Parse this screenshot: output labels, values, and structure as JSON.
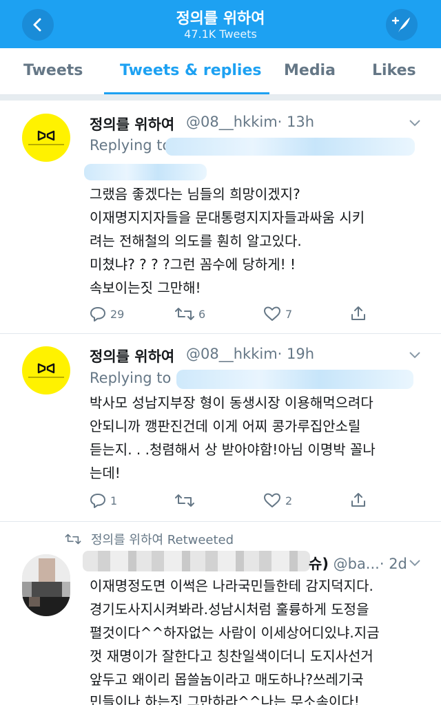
{
  "header": {
    "title": "정의를 위하여",
    "subtitle": "47.1K Tweets",
    "back_icon": "chevron-left-icon",
    "compose_icon": "compose-tweet-icon"
  },
  "tabs": [
    {
      "label": "Tweets",
      "active": false
    },
    {
      "label": "Tweets & replies",
      "active": true
    },
    {
      "label": "Media",
      "active": false
    },
    {
      "label": "Likes",
      "active": false
    }
  ],
  "tweets": [
    {
      "name": "정의를 위하여",
      "handle": "@08__hkkim",
      "time": "· 13h",
      "replying": "Replying to",
      "lines": [
        "그랬음 좋겠다는 님들의 희망이겠지?",
        "이재명지지자들을 문대통령지지자들과싸움 시키",
        "려는 전해철의 의도를 훤히 알고있다.",
        "미쳤냐? ? ? ?그런 꼼수에 당하게! !",
        "속보이는짓 그만해!"
      ],
      "replies": "29",
      "retweets": "6",
      "likes": "7"
    },
    {
      "name": "정의를 위하여",
      "handle": "@08__hkkim",
      "time": "· 19h",
      "replying": "Replying to",
      "lines": [
        "박사모 성남지부장 형이 동생시장 이용해먹으려다",
        "안되니까 깽판진건데 이게 어찌 콩가루집안소릴",
        "듣는지. . .청렴해서 상 받아야함!아님 이명박 꼴나",
        "는데!"
      ],
      "replies": "1",
      "retweets": "",
      "likes": "2"
    }
  ],
  "retweet": {
    "label": "정의를 위하여 Retweeted",
    "name_suffix": "슈)",
    "handle": "@ba...",
    "time": "· 2d",
    "lines": [
      "이재명정도면 이썩은 나라국민들한테 감지덕지다.",
      "경기도사지시켜봐라.성남시처럼 훌륭하게 도정을",
      "펼것이다^^하자없는 사람이 이세상어디있냐.지금",
      "껏 재명이가 잘한다고 칭찬일색이더니 도지사선거",
      "앞두고 왜이리 몹쓸놈이라고 매도하나?쓰레기국",
      "민들이나 하는짓 그만하라^^나는 무소속이다!"
    ]
  },
  "colors": {
    "brand": "#1da1f2",
    "text": "#14171a",
    "muted": "#657786",
    "avatar": "#fff200"
  }
}
